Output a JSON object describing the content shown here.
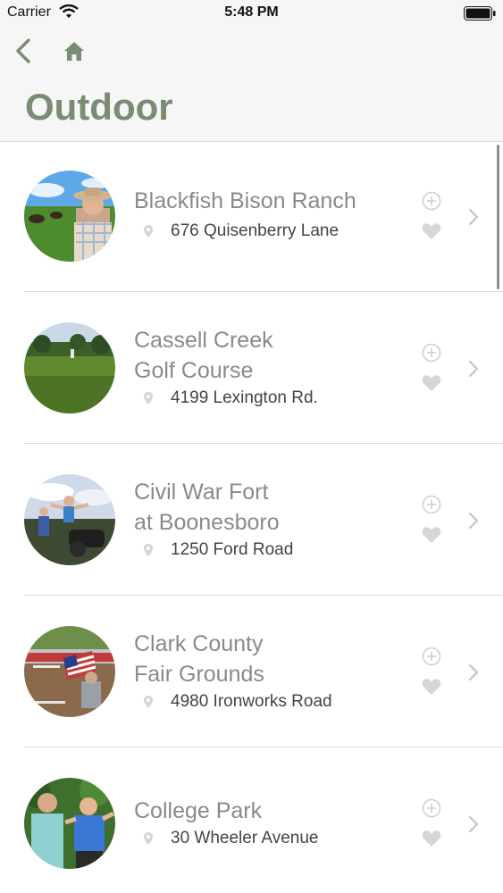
{
  "status_bar": {
    "carrier": "Carrier",
    "time": "5:48 PM"
  },
  "header": {
    "title": "Outdoor"
  },
  "colors": {
    "accent": "#7a8c72",
    "name_text": "#8a8a8a",
    "address_text": "#444444",
    "icon_gray": "#cfcfcf"
  },
  "places": [
    {
      "name_line1": "Blackfish Bison Ranch",
      "name_line2": "",
      "address": "676 Quisenberry Lane"
    },
    {
      "name_line1": "Cassell Creek",
      "name_line2": "Golf Course",
      "address": "4199 Lexington Rd."
    },
    {
      "name_line1": "Civil War Fort",
      "name_line2": "at Boonesboro",
      "address": "1250 Ford Road"
    },
    {
      "name_line1": "Clark County",
      "name_line2": "Fair Grounds",
      "address": "4980 Ironworks Road"
    },
    {
      "name_line1": "College Park",
      "name_line2": "",
      "address": "30 Wheeler Avenue"
    }
  ]
}
